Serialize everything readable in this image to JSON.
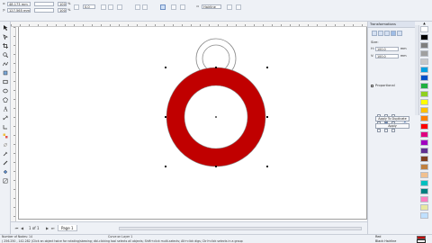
{
  "property_bar": {
    "x_value": "48.173 mm",
    "y_value": "127.565 mm",
    "width_value": "100.0",
    "height_value": "100.0",
    "scale_unit": "%",
    "angle_value": "0.0",
    "outline_width": "Hairline",
    "tooltip": "Outline Style Selector"
  },
  "ruler_numbers": [
    "100",
    "150",
    "200",
    "250",
    "300",
    "350"
  ],
  "page_tabs": {
    "page_counter": "1 of 1",
    "page_label": "Page 1"
  },
  "status": {
    "object_count": "Number of Nodes: 14",
    "coords": "( 256.250 , 142.282 )",
    "hint": "Click an object twice for rotating/skewing; dbl-clicking tool selects all objects; Shift+click multi-selects; Alt+click digs; Ctrl+click selects in a group",
    "layer": "Curve on Layer 1",
    "fill_label": "Red",
    "outline_label": "Black  Hairline"
  },
  "docker": {
    "title": "Transformations",
    "size_label": "Size:",
    "h_value": "100.0",
    "v_value": "100.0",
    "unit": "mm",
    "proportional_label": "Proportional",
    "apply_duplicate_label": "Apply To Duplicate",
    "apply_label": "Apply"
  },
  "drawing": {
    "ring_fill": "#c00000",
    "ring_outline": "#8a8a8a"
  },
  "palette": {
    "colors": [
      "#ffffff",
      "#000000",
      "#7f7f7f",
      "#a0a0a0",
      "#c8c8c8",
      "#00a0e0",
      "#0050c8",
      "#20b040",
      "#90d020",
      "#ffff00",
      "#ffc000",
      "#ff8000",
      "#ff0000",
      "#e00080",
      "#a000c0",
      "#603090",
      "#804020",
      "#c08040",
      "#f0c090",
      "#00c0c0",
      "#008080",
      "#ff80c0",
      "#e8e8a0",
      "#c0e0ff"
    ]
  }
}
